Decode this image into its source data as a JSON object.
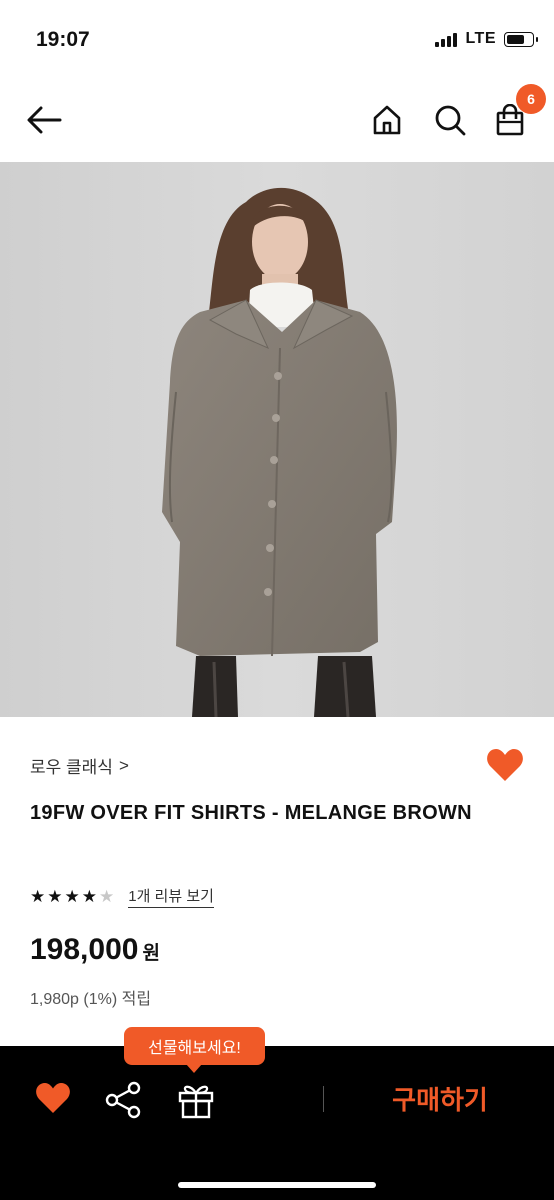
{
  "status_bar": {
    "time": "19:07",
    "network": "LTE"
  },
  "nav": {
    "cart_count": "6"
  },
  "product": {
    "brand": "로우 클래식",
    "brand_chevron": ">",
    "name": "19FW OVER FIT SHIRTS - MELANGE BROWN",
    "rating": 4,
    "rating_max": 5,
    "review_link": "1개 리뷰 보기",
    "price": "198,000",
    "price_unit": "원",
    "points_text": "1,980p (1%) 적립"
  },
  "bottom_bar": {
    "gift_tooltip": "선물해보세요!",
    "buy_label": "구매하기"
  },
  "colors": {
    "accent": "#f05a28",
    "bar_bg": "#000000",
    "photo_bg": "#d7d7d7"
  }
}
